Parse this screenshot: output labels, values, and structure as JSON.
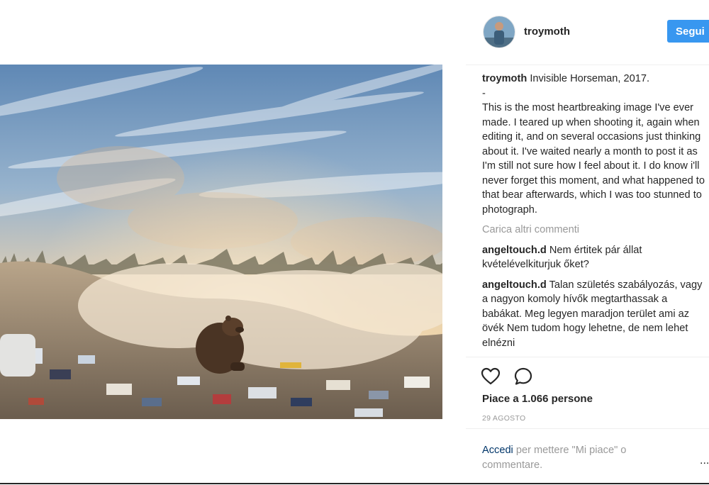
{
  "post": {
    "username": "troymoth",
    "follow_label": "Segui",
    "photo_alt": "Bear sitting among garbage in a smoky landfill at sunset",
    "comments": [
      {
        "author": "troymoth",
        "text": "Invisible Horseman, 2017.\n-\nThis is the most heartbreaking image I've ever made. I teared up when shooting it, again when editing it, and on several occasions just thinking about it. I've waited nearly a month to post it as I'm still not sure how I feel about it. I do know i'll never forget this moment, and what happened to that bear afterwards, which I was too stunned to photograph."
      },
      {
        "author": "angeltouch.d",
        "text": "Nem értitek pár állat kvételévelkiturjuk őket?"
      },
      {
        "author": "angeltouch.d",
        "text": "Talan születés szabályozás, vagy a nagyon komoly hívők megtarthassak a babákat. Meg legyen maradjon terület ami az övék Nem tudom hogy lehetne, de nem lehet elnézni"
      }
    ],
    "load_more_label": "Carica altri commenti",
    "likes_text": "Piace a 1.066 persone",
    "date": "29 AGOSTO",
    "login_link": "Accedi",
    "login_text": " per mettere \"Mi piace\" o commentare.",
    "more_label": "...",
    "icons": {
      "like": "heart-outline-icon",
      "comment": "speech-bubble-icon"
    }
  },
  "colors": {
    "accent": "#3897f0",
    "link_dark": "#003569",
    "muted": "#999999",
    "text": "#262626"
  }
}
